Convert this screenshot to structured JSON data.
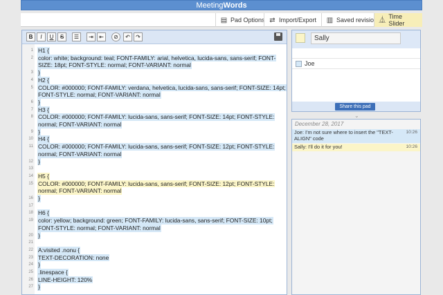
{
  "app": {
    "title_prefix": "Meeting",
    "title_suffix": "Words"
  },
  "toolbar": {
    "pad_options": "Pad Options",
    "import_export": "Import/Export",
    "saved_revisions": "Saved revisions",
    "time_slider": "Time Slider"
  },
  "editor_toolbar": {
    "bold": "B",
    "italic": "I",
    "underline": "U",
    "strike": "S"
  },
  "lines": [
    {
      "n": "1",
      "text": "H1 {",
      "author": "joe"
    },
    {
      "n": "2",
      "text": "color: white; background: teal; FONT-FAMILY: arial, helvetica, lucida-sans, sans-serif; FONT-",
      "author": "joe"
    },
    {
      "n": "",
      "text": "SIZE: 18pt; FONT-STYLE: normal; FONT-VARIANT: normal",
      "author": "joe"
    },
    {
      "n": "3",
      "text": "}",
      "author": "joe"
    },
    {
      "n": "4",
      "text": "H2 {",
      "author": "joe"
    },
    {
      "n": "5",
      "text": "COLOR: #000000; FONT-FAMILY: verdana, helvetica, lucida-sans, sans-serif; FONT-SIZE: 14pt;",
      "author": "joe"
    },
    {
      "n": "",
      "text": "FONT-STYLE: normal; FONT-VARIANT: normal",
      "author": "joe"
    },
    {
      "n": "6",
      "text": "}",
      "author": "joe"
    },
    {
      "n": "7",
      "text": "H3 {",
      "author": "joe"
    },
    {
      "n": "8",
      "text": "COLOR: #000000; FONT-FAMILY: lucida-sans, sans-serif; FONT-SIZE: 14pt; FONT-STYLE:",
      "author": "joe"
    },
    {
      "n": "",
      "text": "normal; FONT-VARIANT: normal",
      "author": "joe"
    },
    {
      "n": "9",
      "text": "}",
      "author": "joe"
    },
    {
      "n": "10",
      "text": "H4 {",
      "author": "joe"
    },
    {
      "n": "11",
      "text": "COLOR: #000000; FONT-FAMILY: lucida-sans, sans-serif; FONT-SIZE: 12pt; FONT-STYLE:",
      "author": "joe"
    },
    {
      "n": "",
      "text": "normal; FONT-VARIANT: normal",
      "author": "joe"
    },
    {
      "n": "12",
      "text": "}",
      "author": "joe"
    },
    {
      "n": "13",
      "text": "",
      "author": "none"
    },
    {
      "n": "14",
      "text": "H5 {",
      "author": "sally"
    },
    {
      "n": "15",
      "text": "COLOR: #000000; FONT-FAMILY: lucida-sans, sans-serif; FONT-SIZE: 12pt; FONT-STYLE:",
      "author": "sally"
    },
    {
      "n": "",
      "text": "normal; FONT-VARIANT: normal",
      "author": "sally"
    },
    {
      "n": "16",
      "text": "}",
      "author": "joe"
    },
    {
      "n": "17",
      "text": "",
      "author": "none"
    },
    {
      "n": "18",
      "text": "H6 {",
      "author": "joe"
    },
    {
      "n": "19",
      "text": "color: yellow; background: green; FONT-FAMILY: lucida-sans, sans-serif; FONT-SIZE: 10pt;",
      "author": "joe"
    },
    {
      "n": "",
      "text": "FONT-STYLE: normal; FONT-VARIANT: normal",
      "author": "joe"
    },
    {
      "n": "20",
      "text": "}",
      "author": "joe"
    },
    {
      "n": "21",
      "text": "",
      "author": "none"
    },
    {
      "n": "22",
      "text": "A:visited .nonu {",
      "author": "joe"
    },
    {
      "n": "23",
      "text": "TEXT-DECORATION: none",
      "author": "joe"
    },
    {
      "n": "24",
      "text": "}",
      "author": "joe"
    },
    {
      "n": "25",
      "text": ".linespace {",
      "author": "joe"
    },
    {
      "n": "26",
      "text": "LINE-HEIGHT: 120%",
      "author": "joe"
    },
    {
      "n": "27",
      "text": "}",
      "author": "joe"
    }
  ],
  "users": {
    "me": {
      "name": "Sally",
      "color": "#fbf5c8"
    },
    "others": [
      {
        "name": "Joe",
        "color": "#d5e8f7"
      }
    ],
    "share_label": "Share this pad"
  },
  "chat": {
    "date": "December 28, 2017",
    "messages": [
      {
        "author": "joe",
        "text": "Joe: I'm not sure where to insert the \"TEXT-ALIGN\" code",
        "time": "10:26"
      },
      {
        "author": "sally",
        "text": "Sally: I'll do it for you!",
        "time": "10:26"
      }
    ]
  }
}
